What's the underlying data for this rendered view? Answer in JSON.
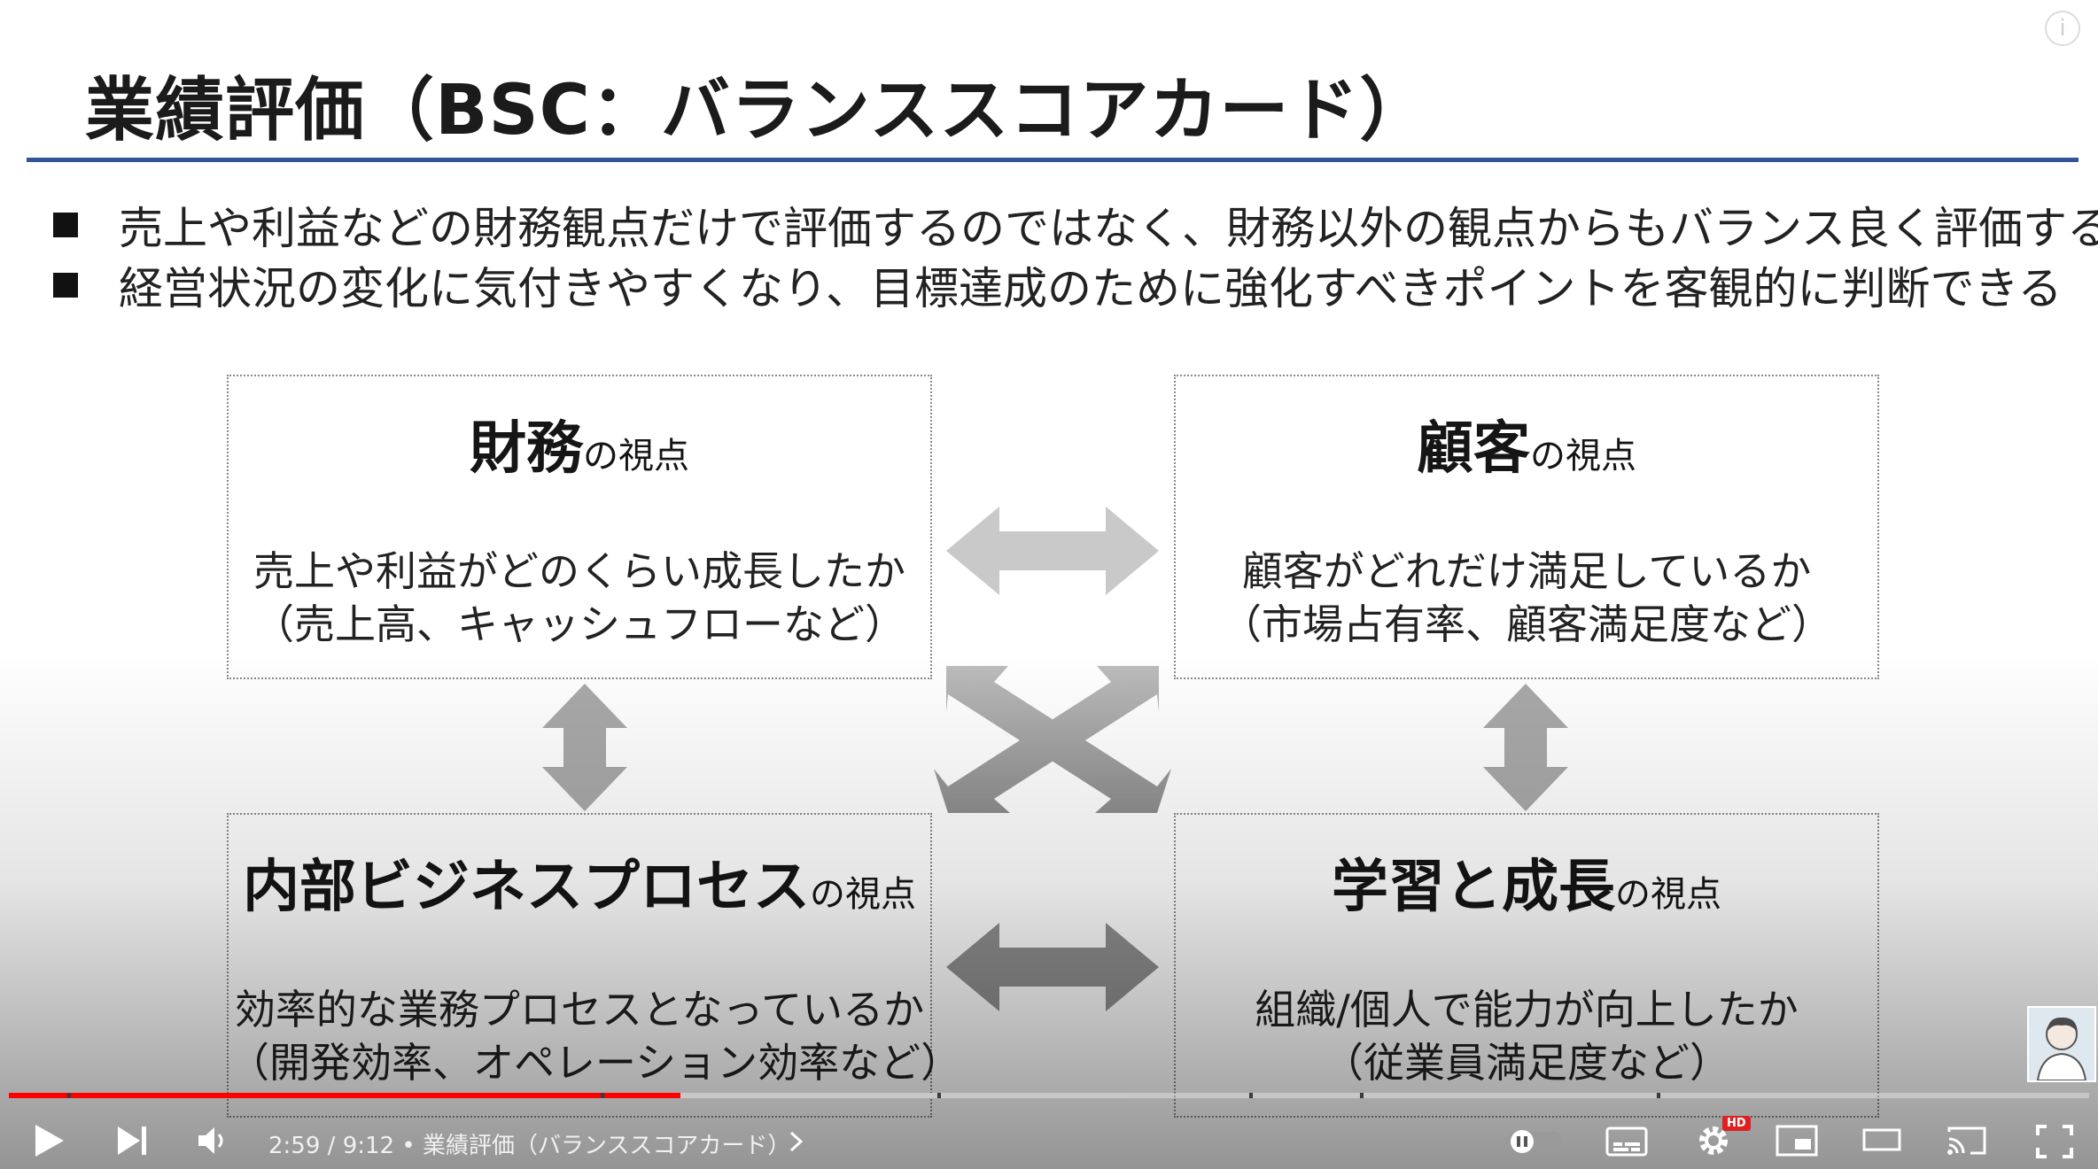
{
  "slide": {
    "title": "業績評価（BSC：バランススコアカード）",
    "bullets": [
      "売上や利益などの財務観点だけで評価するのではなく、財務以外の観点からもバランス良く評価する",
      "経営状況の変化に気付きやすくなり、目標達成のために強化すべきポイントを客観的に判断できる"
    ],
    "perspectives": [
      {
        "title": "財務",
        "suffix": "の視点",
        "line1": "売上や利益がどのくらい成長したか",
        "line2": "（売上高、キャッシュフローなど）"
      },
      {
        "title": "顧客",
        "suffix": "の視点",
        "line1": "顧客がどれだけ満足しているか",
        "line2": "（市場占有率、顧客満足度など）"
      },
      {
        "title": "内部ビジネスプロセス",
        "suffix": "の視点",
        "line1": "効率的な業務プロセスとなっているか",
        "line2": "（開発効率、オペレーション効率など）"
      },
      {
        "title": "学習と成長",
        "suffix": "の視点",
        "line1": "組織/個人で能力が向上したか",
        "line2": "（従業員満足度など）"
      }
    ]
  },
  "player": {
    "time_current": "2:59",
    "time_separator": " / ",
    "time_total": "9:12",
    "chapter_separator": " • ",
    "chapter_title": "業績評価（バランススコアカード）",
    "hd_badge": "HD",
    "progress": {
      "played": 0.323,
      "buffered": 0.538
    },
    "icons": [
      "play-icon",
      "next-icon",
      "volume-icon",
      "chevron-right-icon",
      "autoplay-toggle-icon",
      "subtitles-icon",
      "settings-icon",
      "miniplayer-icon",
      "theater-icon",
      "cast-icon",
      "fullscreen-icon",
      "info-icon"
    ],
    "colors": {
      "played": "#ff0000",
      "buffered": "#c8c8c8",
      "accent": "#2f5597"
    }
  }
}
